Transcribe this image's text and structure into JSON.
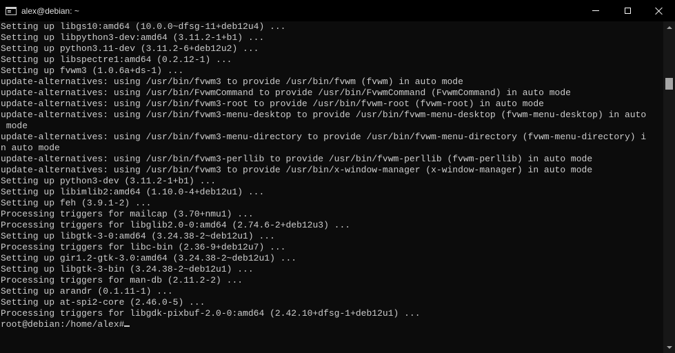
{
  "window": {
    "title": "alex@debian: ~"
  },
  "terminal": {
    "lines": [
      "Setting up libgs10:amd64 (10.0.0~dfsg-11+deb12u4) ...",
      "Setting up libpython3-dev:amd64 (3.11.2-1+b1) ...",
      "Setting up python3.11-dev (3.11.2-6+deb12u2) ...",
      "Setting up libspectre1:amd64 (0.2.12-1) ...",
      "Setting up fvwm3 (1.0.6a+ds-1) ...",
      "update-alternatives: using /usr/bin/fvwm3 to provide /usr/bin/fvwm (fvwm) in auto mode",
      "update-alternatives: using /usr/bin/FvwmCommand to provide /usr/bin/FvwmCommand (FvwmCommand) in auto mode",
      "update-alternatives: using /usr/bin/fvwm3-root to provide /usr/bin/fvwm-root (fvwm-root) in auto mode",
      "update-alternatives: using /usr/bin/fvwm3-menu-desktop to provide /usr/bin/fvwm-menu-desktop (fvwm-menu-desktop) in auto\n mode",
      "update-alternatives: using /usr/bin/fvwm3-menu-directory to provide /usr/bin/fvwm-menu-directory (fvwm-menu-directory) i\nn auto mode",
      "update-alternatives: using /usr/bin/fvwm3-perllib to provide /usr/bin/fvwm-perllib (fvwm-perllib) in auto mode",
      "update-alternatives: using /usr/bin/fvwm3 to provide /usr/bin/x-window-manager (x-window-manager) in auto mode",
      "Setting up python3-dev (3.11.2-1+b1) ...",
      "Setting up libimlib2:amd64 (1.10.0-4+deb12u1) ...",
      "Setting up feh (3.9.1-2) ...",
      "Processing triggers for mailcap (3.70+nmu1) ...",
      "Processing triggers for libglib2.0-0:amd64 (2.74.6-2+deb12u3) ...",
      "Setting up libgtk-3-0:amd64 (3.24.38-2~deb12u1) ...",
      "Processing triggers for libc-bin (2.36-9+deb12u7) ...",
      "Setting up gir1.2-gtk-3.0:amd64 (3.24.38-2~deb12u1) ...",
      "Setting up libgtk-3-bin (3.24.38-2~deb12u1) ...",
      "Processing triggers for man-db (2.11.2-2) ...",
      "Setting up arandr (0.1.11-1) ...",
      "Setting up at-spi2-core (2.46.0-5) ...",
      "Processing triggers for libgdk-pixbuf-2.0-0:amd64 (2.42.10+dfsg-1+deb12u1) ..."
    ],
    "prompt": "root@debian:/home/alex#"
  },
  "colors": {
    "background": "#0c0c0c",
    "foreground": "#cccccc",
    "titlebar": "#000000"
  },
  "icons": {
    "app": "console-icon",
    "minimize": "minimize-icon",
    "maximize": "maximize-icon",
    "close": "close-icon"
  }
}
